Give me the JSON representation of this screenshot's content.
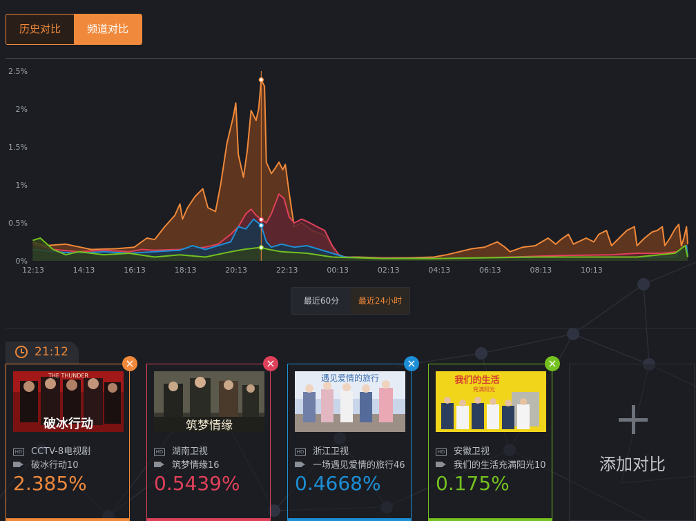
{
  "tabs": {
    "history": "历史对比",
    "channel": "频道对比"
  },
  "range": {
    "recent60": "最近60分",
    "recent24h": "最近24小时"
  },
  "time": "21:12",
  "chart_data": {
    "type": "area",
    "y_ticks": [
      "0%",
      "0.5%",
      "1%",
      "1.5%",
      "2%",
      "2.5%"
    ],
    "ylim": [
      0,
      2.5
    ],
    "x_ticks": [
      "12:13",
      "14:13",
      "16:13",
      "18:13",
      "20:13",
      "22:13",
      "00:13",
      "02:13",
      "04:13",
      "06:13",
      "08:13",
      "10:13"
    ],
    "cursor_time": "21:12",
    "grid": false,
    "series": [
      {
        "color": "#f0893b",
        "fill": "#6a3a1d",
        "points": [
          [
            12.2,
            0.25
          ],
          [
            12.7,
            0.2
          ],
          [
            13.5,
            0.22
          ],
          [
            14.5,
            0.15
          ],
          [
            15.5,
            0.16
          ],
          [
            16.2,
            0.18
          ],
          [
            16.7,
            0.3
          ],
          [
            17.0,
            0.28
          ],
          [
            17.4,
            0.45
          ],
          [
            17.8,
            0.6
          ],
          [
            18.0,
            0.75
          ],
          [
            18.1,
            0.55
          ],
          [
            18.3,
            0.7
          ],
          [
            18.6,
            0.85
          ],
          [
            18.9,
            0.95
          ],
          [
            19.1,
            0.7
          ],
          [
            19.4,
            0.65
          ],
          [
            19.6,
            1.0
          ],
          [
            19.85,
            1.55
          ],
          [
            20.1,
            1.9
          ],
          [
            20.2,
            2.08
          ],
          [
            20.3,
            1.4
          ],
          [
            20.5,
            1.1
          ],
          [
            20.65,
            1.45
          ],
          [
            20.8,
            1.98
          ],
          [
            21.0,
            1.85
          ],
          [
            21.1,
            2.0
          ],
          [
            21.2,
            2.385
          ],
          [
            21.33,
            2.3
          ],
          [
            21.4,
            1.3
          ],
          [
            21.6,
            1.15
          ],
          [
            21.75,
            1.22
          ],
          [
            21.9,
            1.3
          ],
          [
            22.05,
            1.2
          ],
          [
            22.15,
            1.27
          ],
          [
            22.3,
            0.9
          ],
          [
            22.5,
            0.45
          ],
          [
            22.8,
            0.5
          ],
          [
            23.2,
            0.4
          ],
          [
            23.6,
            0.35
          ],
          [
            23.85,
            0.28
          ],
          [
            24.1,
            0.1
          ],
          [
            24.5,
            0.05
          ],
          [
            25.0,
            0.05
          ],
          [
            26.0,
            0.04
          ],
          [
            27.0,
            0.04
          ],
          [
            28.0,
            0.05
          ],
          [
            28.5,
            0.08
          ],
          [
            29.0,
            0.12
          ],
          [
            29.5,
            0.16
          ],
          [
            30.0,
            0.18
          ],
          [
            30.5,
            0.25
          ],
          [
            30.8,
            0.18
          ],
          [
            31.0,
            0.12
          ],
          [
            31.5,
            0.18
          ],
          [
            32.0,
            0.2
          ],
          [
            32.5,
            0.3
          ],
          [
            32.8,
            0.22
          ],
          [
            33.0,
            0.28
          ],
          [
            33.3,
            0.35
          ],
          [
            33.5,
            0.22
          ],
          [
            34.0,
            0.3
          ],
          [
            34.3,
            0.25
          ],
          [
            34.5,
            0.35
          ],
          [
            34.8,
            0.4
          ],
          [
            35.0,
            0.2
          ],
          [
            35.3,
            0.3
          ],
          [
            35.6,
            0.4
          ],
          [
            35.9,
            0.45
          ],
          [
            36.0,
            0.2
          ],
          [
            36.3,
            0.3
          ],
          [
            36.6,
            0.38
          ],
          [
            36.8,
            0.4
          ],
          [
            37.0,
            0.45
          ],
          [
            37.1,
            0.2
          ],
          [
            37.3,
            0.3
          ],
          [
            37.5,
            0.42
          ],
          [
            37.65,
            0.48
          ],
          [
            37.75,
            0.2
          ],
          [
            37.85,
            0.3
          ],
          [
            37.95,
            0.45
          ],
          [
            38.0,
            0.22
          ]
        ]
      },
      {
        "color": "#e0415a",
        "fill": "#5a2330",
        "points": [
          [
            12.2,
            0.22
          ],
          [
            13.0,
            0.15
          ],
          [
            14.0,
            0.12
          ],
          [
            15.0,
            0.14
          ],
          [
            16.0,
            0.12
          ],
          [
            16.5,
            0.15
          ],
          [
            17.0,
            0.14
          ],
          [
            18.0,
            0.15
          ],
          [
            19.0,
            0.18
          ],
          [
            19.5,
            0.22
          ],
          [
            20.0,
            0.35
          ],
          [
            20.3,
            0.45
          ],
          [
            20.6,
            0.62
          ],
          [
            20.8,
            0.68
          ],
          [
            21.0,
            0.6
          ],
          [
            21.2,
            0.5439
          ],
          [
            21.4,
            0.5
          ],
          [
            21.6,
            0.62
          ],
          [
            21.9,
            0.88
          ],
          [
            22.1,
            0.82
          ],
          [
            22.3,
            0.58
          ],
          [
            22.5,
            0.5
          ],
          [
            22.8,
            0.55
          ],
          [
            23.0,
            0.52
          ],
          [
            23.4,
            0.45
          ],
          [
            23.7,
            0.4
          ],
          [
            24.0,
            0.2
          ],
          [
            24.3,
            0.06
          ],
          [
            25.0,
            0.04
          ],
          [
            27.0,
            0.03
          ],
          [
            29.0,
            0.03
          ],
          [
            31.0,
            0.05
          ],
          [
            33.0,
            0.07
          ],
          [
            35.0,
            0.08
          ],
          [
            36.0,
            0.1
          ],
          [
            37.0,
            0.1
          ],
          [
            37.6,
            0.12
          ],
          [
            37.9,
            0.05
          ],
          [
            38.0,
            0.04
          ]
        ]
      },
      {
        "color": "#1d8fd6",
        "fill": "#183750",
        "points": [
          [
            12.2,
            0.15
          ],
          [
            13.0,
            0.12
          ],
          [
            14.0,
            0.1
          ],
          [
            15.0,
            0.12
          ],
          [
            16.0,
            0.1
          ],
          [
            17.0,
            0.12
          ],
          [
            18.0,
            0.14
          ],
          [
            18.5,
            0.2
          ],
          [
            19.0,
            0.15
          ],
          [
            19.5,
            0.2
          ],
          [
            20.0,
            0.25
          ],
          [
            20.3,
            0.45
          ],
          [
            20.6,
            0.42
          ],
          [
            20.9,
            0.55
          ],
          [
            21.2,
            0.4668
          ],
          [
            21.4,
            0.25
          ],
          [
            21.6,
            0.18
          ],
          [
            22.0,
            0.22
          ],
          [
            22.5,
            0.18
          ],
          [
            23.0,
            0.2
          ],
          [
            23.5,
            0.15
          ],
          [
            24.0,
            0.1
          ],
          [
            24.5,
            0.05
          ],
          [
            26.0,
            0.03
          ],
          [
            28.0,
            0.03
          ],
          [
            30.0,
            0.04
          ],
          [
            32.0,
            0.05
          ],
          [
            34.0,
            0.05
          ],
          [
            36.0,
            0.05
          ],
          [
            37.5,
            0.05
          ],
          [
            37.8,
            0.18
          ],
          [
            37.95,
            0.2
          ],
          [
            38.0,
            0.05
          ]
        ]
      },
      {
        "color": "#74c11f",
        "fill": "#2f3f1e",
        "points": [
          [
            12.2,
            0.27
          ],
          [
            12.5,
            0.3
          ],
          [
            13.0,
            0.15
          ],
          [
            13.5,
            0.08
          ],
          [
            14.0,
            0.12
          ],
          [
            15.0,
            0.08
          ],
          [
            16.0,
            0.1
          ],
          [
            17.0,
            0.05
          ],
          [
            18.0,
            0.08
          ],
          [
            19.0,
            0.05
          ],
          [
            20.0,
            0.12
          ],
          [
            20.5,
            0.15
          ],
          [
            21.0,
            0.17
          ],
          [
            21.2,
            0.175
          ],
          [
            21.5,
            0.15
          ],
          [
            22.0,
            0.12
          ],
          [
            23.0,
            0.1
          ],
          [
            24.0,
            0.05
          ],
          [
            26.0,
            0.03
          ],
          [
            28.0,
            0.03
          ],
          [
            30.0,
            0.04
          ],
          [
            32.0,
            0.05
          ],
          [
            34.0,
            0.05
          ],
          [
            36.0,
            0.05
          ],
          [
            37.5,
            0.1
          ],
          [
            37.9,
            0.2
          ],
          [
            38.0,
            0.05
          ]
        ]
      }
    ]
  },
  "cards": [
    {
      "channel": "CCTV-8电视剧",
      "show": "破冰行动10",
      "rating": "2.385%",
      "color": "#f0893b",
      "poster_text": "破冰行动",
      "poster_top": "THE THUNDER"
    },
    {
      "channel": "湖南卫视",
      "show": "筑梦情缘16",
      "rating": "0.5439%",
      "color": "#e0415a",
      "poster_text": "筑梦情缘"
    },
    {
      "channel": "浙江卫视",
      "show": "一场遇见爱情的旅行46",
      "rating": "0.4668%",
      "color": "#1d8fd6",
      "poster_text": "遇见爱情的旅行"
    },
    {
      "channel": "安徽卫视",
      "show": "我们的生活充满阳光10",
      "rating": "0.175%",
      "color": "#74c11f",
      "poster_text": "我们的生活",
      "poster_sub": "充满阳光"
    }
  ],
  "add_label": "添加对比",
  "close_glyph": "×",
  "hd_glyph": "HD"
}
